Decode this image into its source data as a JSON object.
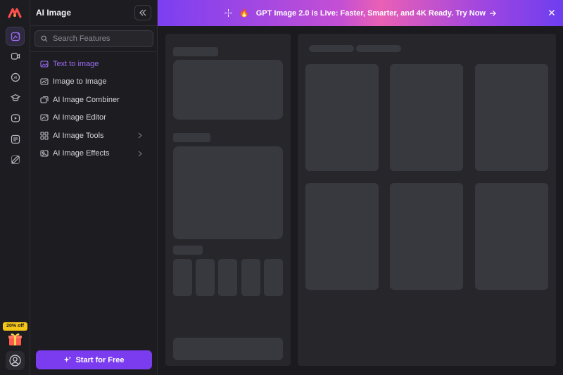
{
  "app": {
    "title": "AI Image"
  },
  "colors": {
    "accent": "#7b3cf0",
    "accent_text": "#9b6cf5",
    "badge": "#f5c518"
  },
  "rail": {
    "items": [
      {
        "icon": "image-edit-icon",
        "active": true
      },
      {
        "icon": "video-icon",
        "active": false
      },
      {
        "icon": "ai-chat-icon",
        "active": false
      },
      {
        "icon": "graduation-cap-icon",
        "active": false
      },
      {
        "icon": "play-icon",
        "active": false
      },
      {
        "icon": "document-icon",
        "active": false
      },
      {
        "icon": "pen-icon",
        "active": false
      }
    ],
    "promo_badge": "20% off",
    "gift_icon": "gift-icon",
    "avatar_icon": "user-avatar-icon"
  },
  "search": {
    "placeholder": "Search Features"
  },
  "menu": {
    "items": [
      {
        "label": "Text to image",
        "icon": "text-image-icon",
        "active": true,
        "has_submenu": false
      },
      {
        "label": "Image to Image",
        "icon": "image-to-image-icon",
        "active": false,
        "has_submenu": false
      },
      {
        "label": "AI Image Combiner",
        "icon": "image-combine-icon",
        "active": false,
        "has_submenu": false
      },
      {
        "label": "AI Image Editor",
        "icon": "image-editor-icon",
        "active": false,
        "has_submenu": false
      },
      {
        "label": "AI Image Tools",
        "icon": "grid-tools-icon",
        "active": false,
        "has_submenu": true
      },
      {
        "label": "AI Image Effects",
        "icon": "image-effects-icon",
        "active": false,
        "has_submenu": true
      }
    ]
  },
  "start_button": {
    "label": "Start for Free",
    "icon": "sparkle-icon"
  },
  "banner": {
    "text": "GPT Image 2.0 is Live: Faster, Smarter, and 4K Ready. Try Now",
    "fire_icon": "🔥"
  }
}
